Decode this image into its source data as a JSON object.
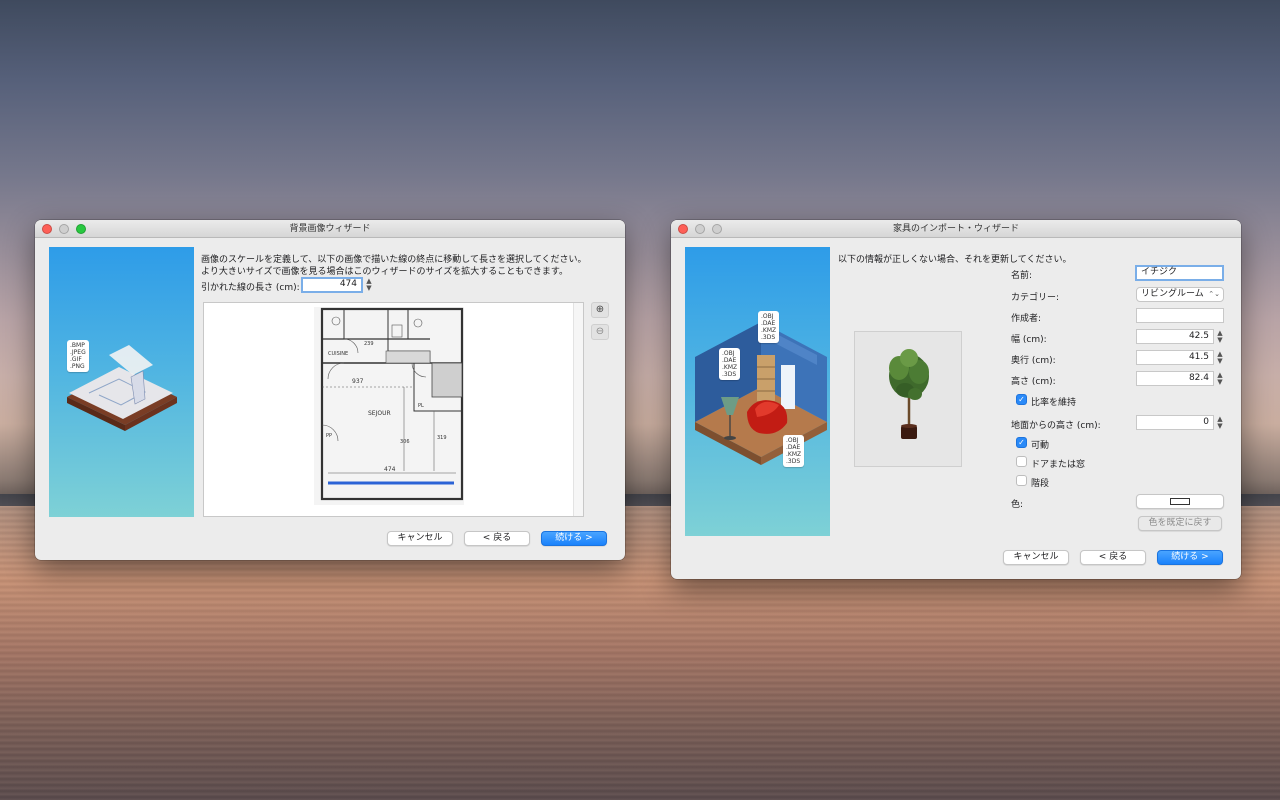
{
  "background_wizard": {
    "title": "背景画像ウィザード",
    "instructions_line1": "画像のスケールを定義して、以下の画像で描いた線の終点に移動して長さを選択してください。",
    "instructions_line2": "より大きいサイズで画像を見る場合はこのウィザードのサイズを拡大することもできます。",
    "length_label": "引かれた線の長さ (cm):",
    "length_value": "474",
    "file_formats": [
      ".BMP",
      ".JPEG",
      ".GIF",
      ".PNG"
    ],
    "plan_labels": {
      "sejour": "SEJOUR",
      "cuisine": "CUISINE",
      "dim_474": "474",
      "dim_937": "937",
      "dim_319": "319",
      "dim_306": "306",
      "dim_239": "239",
      "pp": "PP",
      "pl": "PL"
    },
    "buttons": {
      "cancel": "キャンセル",
      "back": "< 戻る",
      "next": "続ける >"
    },
    "colors": {
      "accent_line": "#2b63d6"
    }
  },
  "furniture_wizard": {
    "title": "家具のインポート・ウィザード",
    "instructions": "以下の情報が正しくない場合、それを更新してください。",
    "file_formats_a": [
      ".OBJ",
      ".DAE",
      ".KMZ",
      ".3DS"
    ],
    "file_formats_b": [
      ".OBJ",
      ".DAE",
      ".KMZ",
      ".3DS"
    ],
    "file_formats_c": [
      ".OBJ",
      ".DAE",
      ".KMZ",
      ".3DS"
    ],
    "fields": {
      "name_label": "名前:",
      "name_value": "イチジク",
      "category_label": "カテゴリー:",
      "category_value": "リビングルーム",
      "creator_label": "作成者:",
      "creator_value": "",
      "width_label": "幅 (cm):",
      "width_value": "42.5",
      "depth_label": "奥行 (cm):",
      "depth_value": "41.5",
      "height_label": "高さ (cm):",
      "height_value": "82.4",
      "keep_ratio_label": "比率を維持",
      "elevation_label": "地面からの高さ (cm):",
      "elevation_value": "0",
      "movable_label": "可動",
      "door_window_label": "ドアまたは窓",
      "staircase_label": "階段",
      "color_label": "色:",
      "reset_color_label": "色を既定に戻す"
    },
    "checks": {
      "keep_ratio": true,
      "movable": true,
      "door_window": false,
      "staircase": false
    },
    "buttons": {
      "cancel": "キャンセル",
      "back": "< 戻る",
      "next": "続ける >"
    }
  },
  "icons": {
    "zoom_in": "zoom-in-icon",
    "zoom_out": "zoom-out-icon",
    "stepper": "stepper-arrows-icon",
    "chevron": "chevron-updown-icon",
    "checkmark": "checkmark-icon"
  }
}
